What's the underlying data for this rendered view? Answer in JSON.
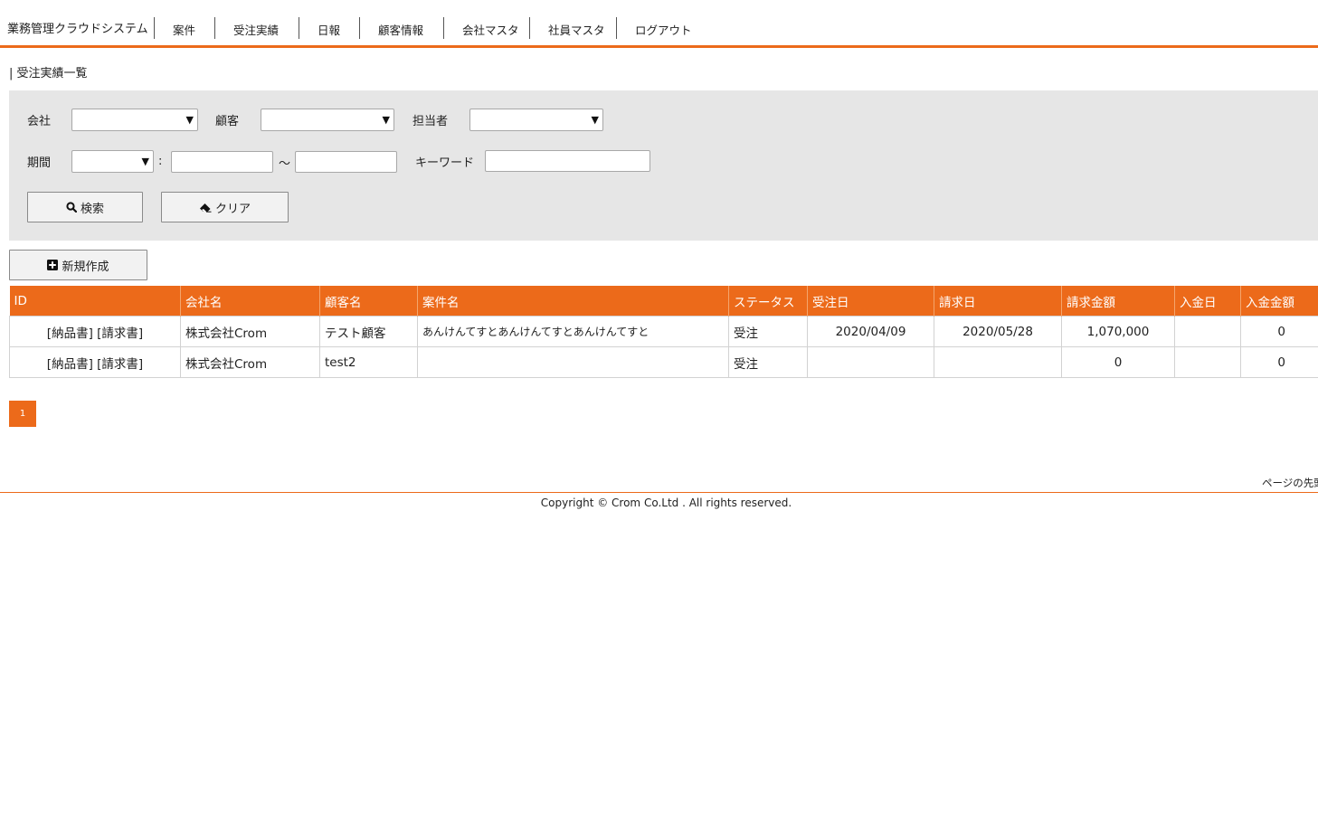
{
  "nav": {
    "brand": "業務管理クラウドシステム",
    "items": [
      {
        "label": "案件"
      },
      {
        "label": "受注実績"
      },
      {
        "label": "日報"
      },
      {
        "label": "顧客情報"
      },
      {
        "label": "会社マスタ"
      },
      {
        "label": "社員マスタ"
      },
      {
        "label": "ログアウト"
      }
    ]
  },
  "page": {
    "title": "| 受注実績一覧"
  },
  "search": {
    "company_label": "会社",
    "company_value": "",
    "customer_label": "顧客",
    "customer_value": "",
    "staff_label": "担当者",
    "staff_value": "",
    "period_label": "期間",
    "period_type_value": "",
    "period_colon": ":",
    "period_from": "",
    "period_tilde": "～",
    "period_to": "",
    "keyword_label": "キーワード",
    "keyword_value": "",
    "search_button": "検索",
    "clear_button": "クリア"
  },
  "actions": {
    "new_button": "新規作成"
  },
  "table": {
    "headers": [
      "ID",
      "会社名",
      "顧客名",
      "案件名",
      "ステータス",
      "受注日",
      "請求日",
      "請求金額",
      "入金日",
      "入金金額"
    ],
    "rows": [
      {
        "delivery_link": "[納品書]",
        "invoice_link": "[請求書]",
        "company": "株式会社Crom",
        "customer": "テスト顧客",
        "project": "あんけんてすとあんけんてすとあんけんてすと",
        "status": "受注",
        "order_date": "2020/04/09",
        "billing_date": "2020/05/28",
        "billing_amount": "1,070,000",
        "payment_date": "",
        "payment_amount": "0"
      },
      {
        "delivery_link": "[納品書]",
        "invoice_link": "[請求書]",
        "company": "株式会社Crom",
        "customer": "test2",
        "project": "",
        "status": "受注",
        "order_date": "",
        "billing_date": "",
        "billing_amount": "0",
        "payment_date": "",
        "payment_amount": "0"
      }
    ]
  },
  "pagination": {
    "current": "1"
  },
  "footer": {
    "page_top": "ページの先頭へ",
    "copyright": "Copyright © Crom Co.Ltd . All rights reserved."
  },
  "colors": {
    "accent": "#ec6a1a",
    "panel_bg": "#e6e6e6"
  },
  "icons": {
    "search_button_icon": "search-icon",
    "clear_button_icon": "eraser-icon",
    "new_button_icon": "plus-square-icon",
    "select_arrow": "dropdown-arrow-icon"
  }
}
